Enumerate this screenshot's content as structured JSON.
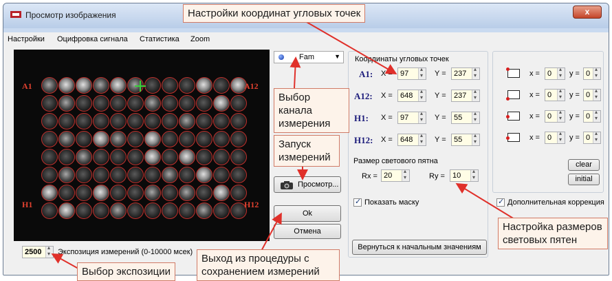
{
  "window": {
    "title": "Просмотр изображения",
    "close_label": "x"
  },
  "menu": [
    "Настройки",
    "Оцифровка сигнала",
    "Статистика",
    "Zoom"
  ],
  "image": {
    "corner_labels": {
      "a1": "A1",
      "a12": "A12",
      "h1": "H1",
      "h12": "H12"
    }
  },
  "channel": {
    "selected": "Fam"
  },
  "buttons": {
    "preview": "Просмотр...",
    "ok": "Ok",
    "cancel": "Отмена",
    "reset": "Вернуться к начальным значениям",
    "clear": "clear",
    "initial": "initial"
  },
  "exposure": {
    "value": "2500",
    "label": "Экспозиция измерений (0-10000 мсек)"
  },
  "corners": {
    "group_title": "Координаты угловых точек",
    "rows": [
      {
        "name": "A1:",
        "x": "97",
        "y": "237"
      },
      {
        "name": "A12:",
        "x": "648",
        "y": "237"
      },
      {
        "name": "H1:",
        "x": "97",
        "y": "55"
      },
      {
        "name": "H12:",
        "x": "648",
        "y": "55"
      }
    ],
    "x_prefix": "X =",
    "y_prefix": "Y ="
  },
  "spot": {
    "group_title": "Размер светового пятна",
    "rx_label": "Rx =",
    "rx": "20",
    "ry_label": "Ry =",
    "ry": "10"
  },
  "show_mask": {
    "label": "Показать маску",
    "checked": true
  },
  "correction": {
    "rows": [
      {
        "x": "0",
        "y": "0"
      },
      {
        "x": "0",
        "y": "0"
      },
      {
        "x": "0",
        "y": "0"
      },
      {
        "x": "0",
        "y": "0"
      }
    ],
    "x_prefix": "x =",
    "y_prefix": "y =",
    "extra_label": "Дополнительная коррекция",
    "extra_checked": true
  },
  "callouts": {
    "corners": "Настройки координат угловых точек",
    "channel": "Выбор канала измерения",
    "start": "Запуск измерений",
    "spot_size": "Настройка размеров световых пятен",
    "exit": "Выход из процедуры с сохранением измерений",
    "exposure": "Выбор экспозиции"
  },
  "colors": {
    "callout_border": "#d07a66",
    "arrow": "#e0302a",
    "mask_ring": "#c0302c"
  }
}
